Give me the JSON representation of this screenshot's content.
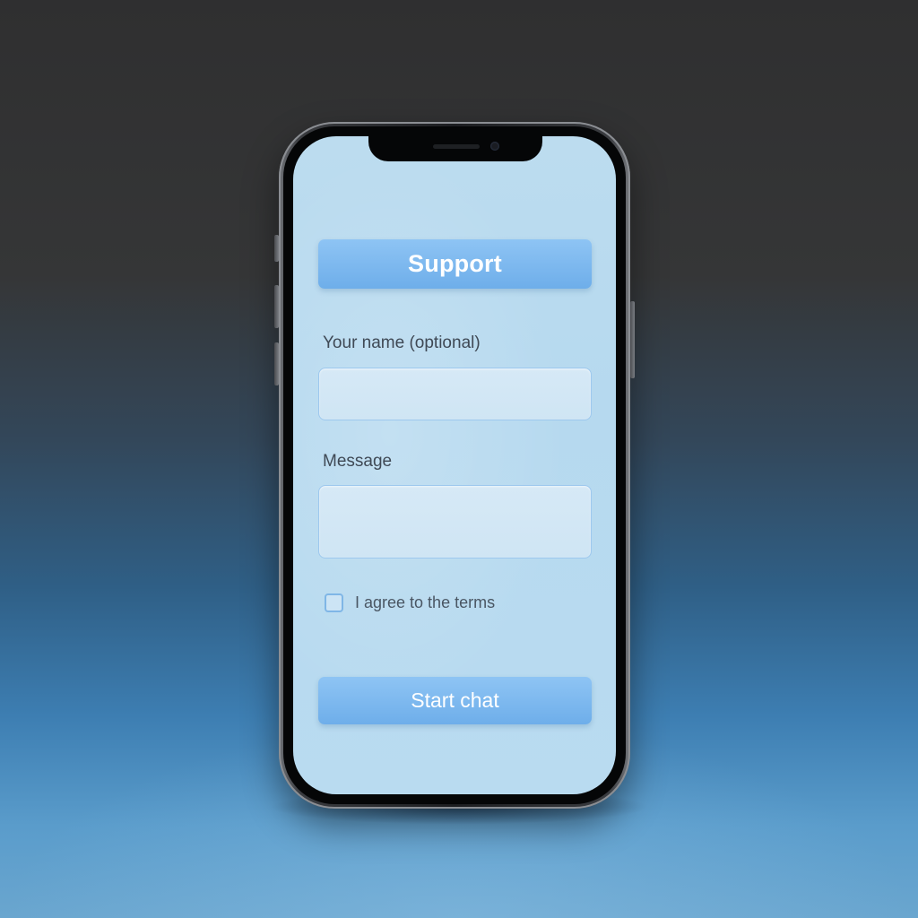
{
  "support_form": {
    "title": "Support",
    "name_label": "Your name (optional)",
    "name_value": "",
    "message_label": "Message",
    "message_value": "",
    "terms_label": "I agree to the terms",
    "terms_checked": false,
    "submit_label": "Start chat"
  },
  "colors": {
    "accent": "#7db9f0",
    "screen_background": "#b8daef",
    "label_text": "#3f4955"
  }
}
